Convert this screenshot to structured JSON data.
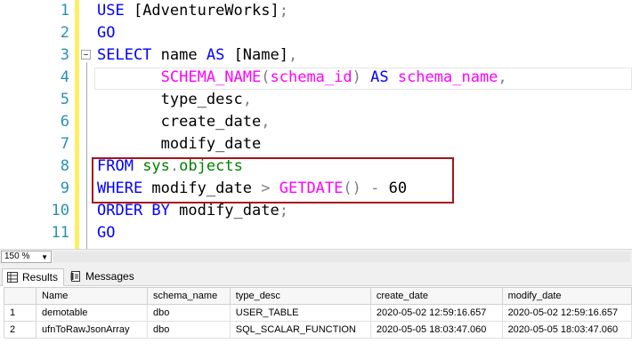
{
  "editor": {
    "line_numbers": [
      "1",
      "2",
      "3",
      "4",
      "5",
      "6",
      "7",
      "8",
      "9",
      "10",
      "11"
    ],
    "lines": [
      [
        {
          "t": "USE ",
          "c": "kw"
        },
        {
          "t": "[AdventureWorks]",
          "c": "id"
        },
        {
          "t": ";",
          "c": "op"
        }
      ],
      [
        {
          "t": "GO",
          "c": "kw"
        }
      ],
      [
        {
          "t": "SELECT ",
          "c": "kw"
        },
        {
          "t": "name ",
          "c": "id"
        },
        {
          "t": "AS ",
          "c": "kw"
        },
        {
          "t": "[Name]",
          "c": "id"
        },
        {
          "t": ",",
          "c": "op"
        }
      ],
      [
        {
          "t": "       ",
          "c": "id"
        },
        {
          "t": "SCHEMA_NAME",
          "c": "fn"
        },
        {
          "t": "(",
          "c": "op"
        },
        {
          "t": "schema_id",
          "c": "fn"
        },
        {
          "t": ") ",
          "c": "op"
        },
        {
          "t": "AS ",
          "c": "kw"
        },
        {
          "t": "schema_name",
          "c": "fn"
        },
        {
          "t": ",",
          "c": "op"
        }
      ],
      [
        {
          "t": "       ",
          "c": "id"
        },
        {
          "t": "type_desc",
          "c": "id"
        },
        {
          "t": ",",
          "c": "op"
        }
      ],
      [
        {
          "t": "       ",
          "c": "id"
        },
        {
          "t": "create_date",
          "c": "id"
        },
        {
          "t": ",",
          "c": "op"
        }
      ],
      [
        {
          "t": "       ",
          "c": "id"
        },
        {
          "t": "modify_date",
          "c": "id"
        }
      ],
      [
        {
          "t": "FROM ",
          "c": "kw"
        },
        {
          "t": "sys",
          "c": "sys"
        },
        {
          "t": ".",
          "c": "op"
        },
        {
          "t": "objects",
          "c": "sys"
        }
      ],
      [
        {
          "t": "WHERE ",
          "c": "kw"
        },
        {
          "t": "modify_date ",
          "c": "id"
        },
        {
          "t": "> ",
          "c": "op"
        },
        {
          "t": "GETDATE",
          "c": "fn"
        },
        {
          "t": "() ",
          "c": "op"
        },
        {
          "t": "- ",
          "c": "op"
        },
        {
          "t": "60",
          "c": "id"
        }
      ],
      [
        {
          "t": "ORDER BY ",
          "c": "kw"
        },
        {
          "t": "modify_date",
          "c": "id"
        },
        {
          "t": ";",
          "c": "op"
        }
      ],
      [
        {
          "t": "GO",
          "c": "kw"
        }
      ]
    ]
  },
  "zoom": {
    "value": "150 %"
  },
  "tabs": {
    "results": "Results",
    "messages": "Messages"
  },
  "grid": {
    "columns": [
      "Name",
      "schema_name",
      "type_desc",
      "create_date",
      "modify_date"
    ],
    "rows": [
      {
        "n": "1",
        "cells": [
          "demotable",
          "dbo",
          "USER_TABLE",
          "2020-05-02 12:59:16.657",
          "2020-05-02 12:59:16.657"
        ]
      },
      {
        "n": "2",
        "cells": [
          "ufnToRawJsonArray",
          "dbo",
          "SQL_SCALAR_FUNCTION",
          "2020-05-05 18:03:47.060",
          "2020-05-05 18:03:47.060"
        ]
      }
    ]
  }
}
